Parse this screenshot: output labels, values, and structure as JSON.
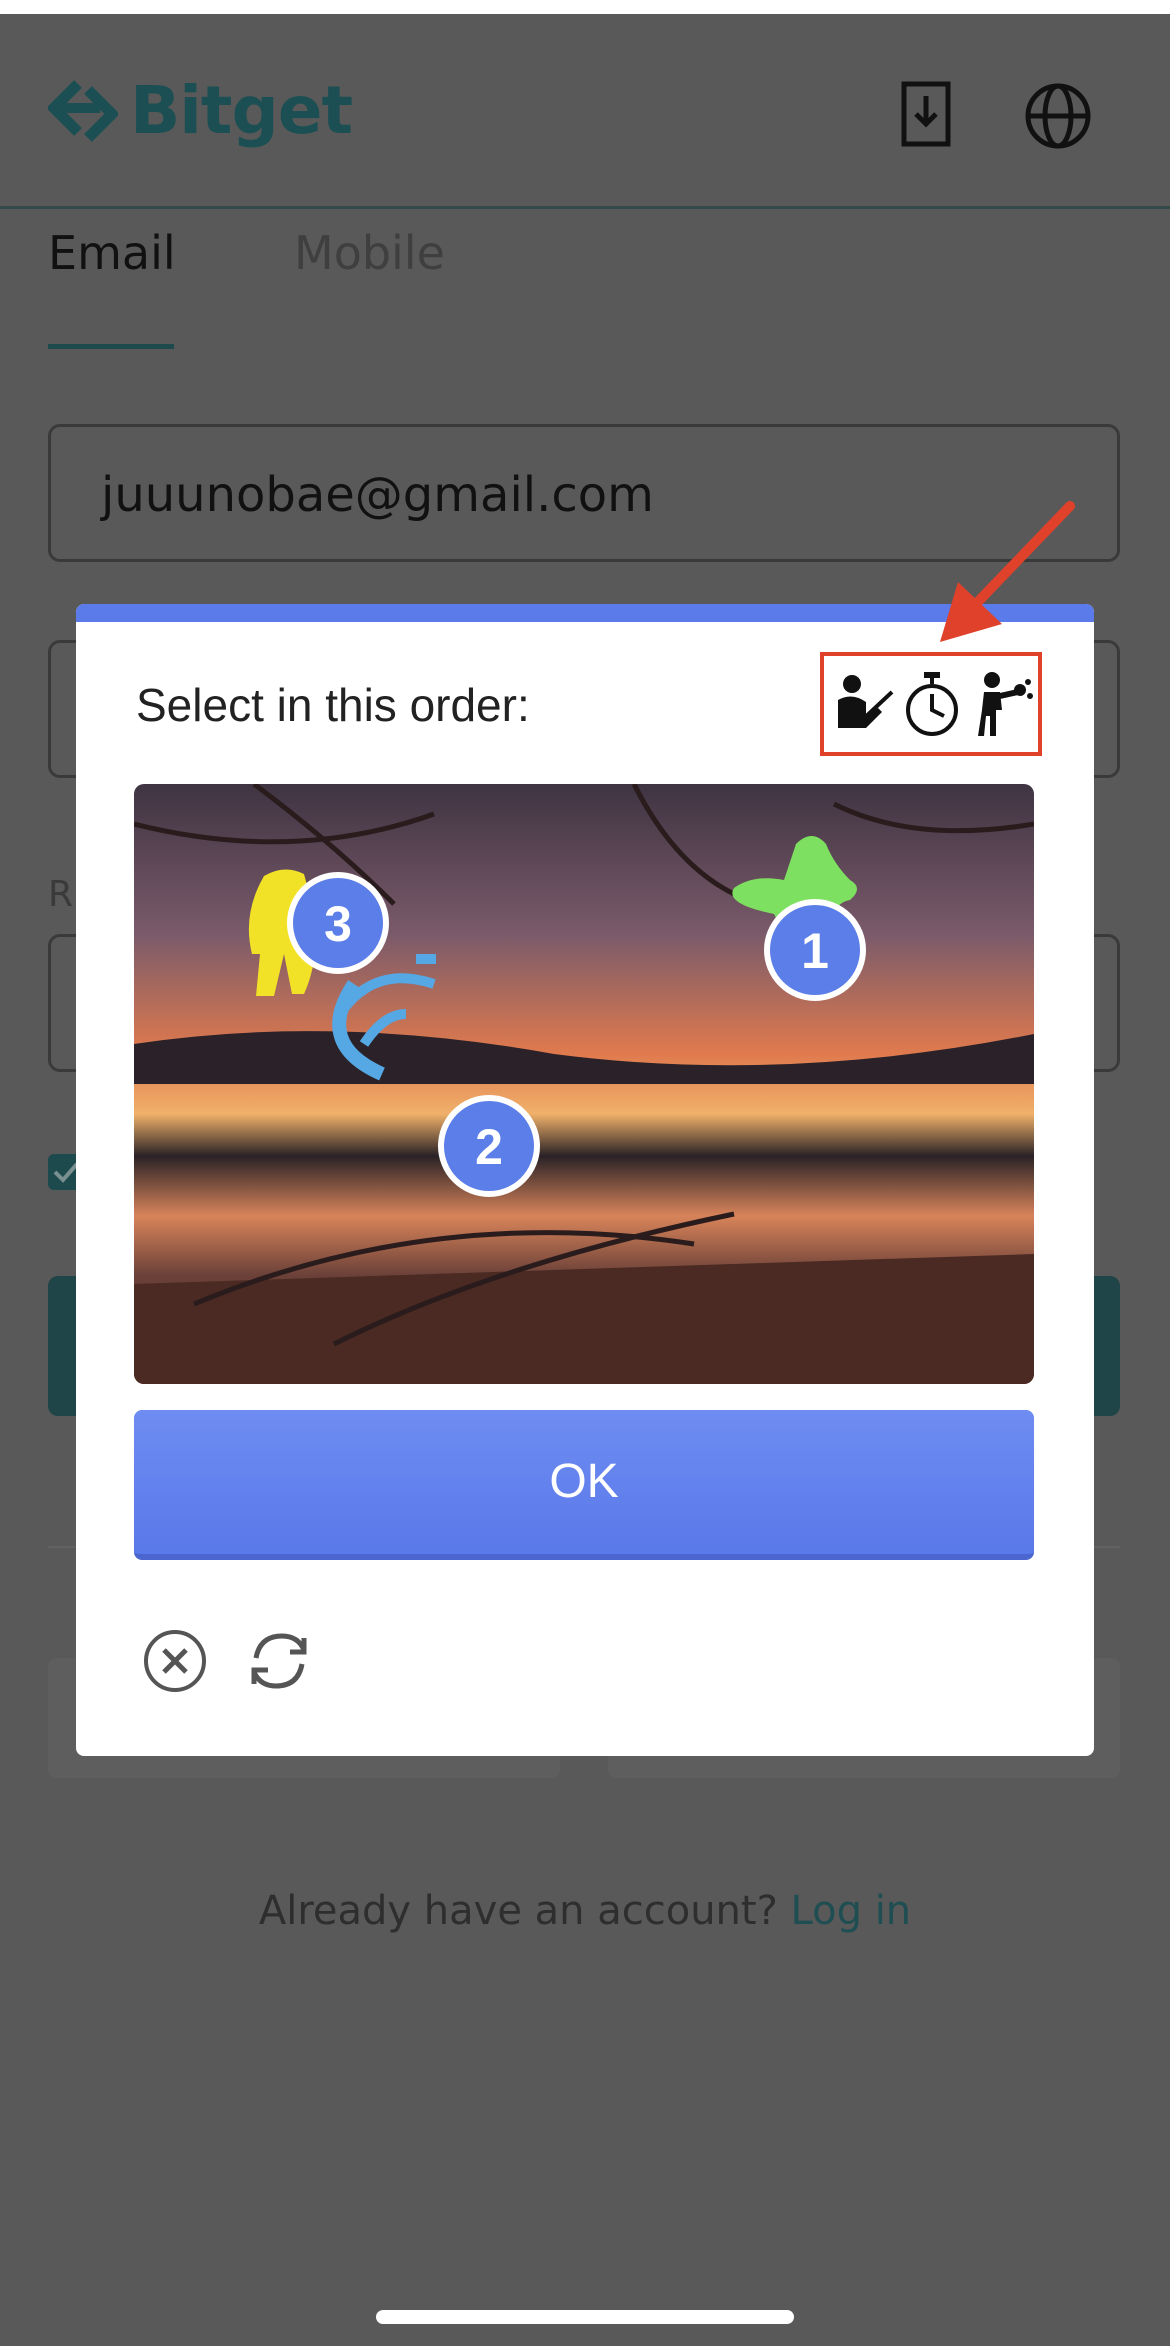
{
  "header": {
    "brand": "Bitget",
    "icons": [
      "download-icon",
      "globe-icon"
    ]
  },
  "tabs": [
    {
      "label": "Email",
      "active": true
    },
    {
      "label": "Mobile",
      "active": false
    }
  ],
  "email_field": {
    "value": "juuunobae@gmail.com"
  },
  "referral_label_partial": "R",
  "captcha": {
    "instruction": "Select in this order:",
    "order_icons": [
      "person-with-tool-icon",
      "stopwatch-icon",
      "person-boxing-icon"
    ],
    "selections": [
      {
        "order": "1",
        "target": "green figure"
      },
      {
        "order": "2",
        "target": "blue stopwatch"
      },
      {
        "order": "3",
        "target": "yellow figure"
      }
    ],
    "ok_label": "OK",
    "controls": [
      "close-icon",
      "refresh-icon"
    ]
  },
  "footer": {
    "prompt": "Already have an account?",
    "link": "Log in"
  },
  "colors": {
    "accent": "#5b7bea",
    "brand": "#1c4f53",
    "highlight_box": "#e0412b"
  }
}
